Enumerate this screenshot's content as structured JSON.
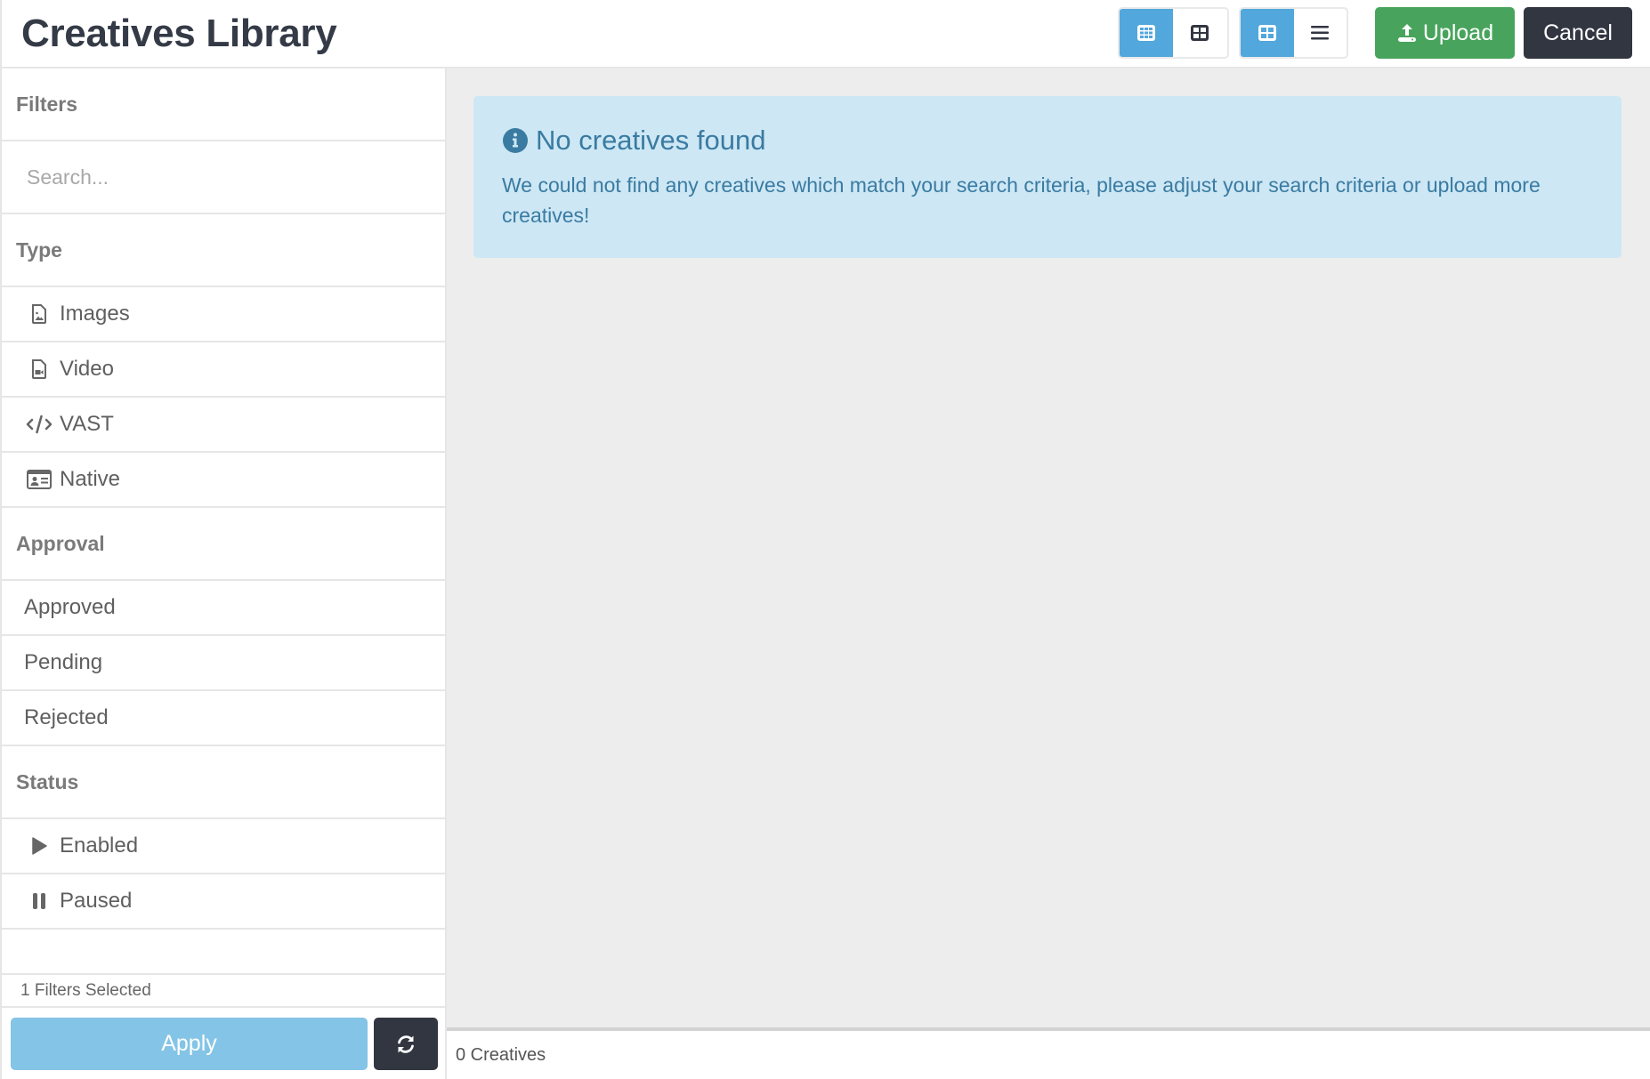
{
  "header": {
    "title": "Creatives Library",
    "view_toggle_1": [
      {
        "icon": "grid-small-icon",
        "active": true
      },
      {
        "icon": "grid-large-icon",
        "active": false
      }
    ],
    "view_toggle_2": [
      {
        "icon": "grid-view-icon",
        "active": true
      },
      {
        "icon": "list-view-icon",
        "active": false
      }
    ],
    "upload_label": "Upload",
    "cancel_label": "Cancel"
  },
  "sidebar": {
    "filters_label": "Filters",
    "search_placeholder": "Search...",
    "search_value": "",
    "type": {
      "label": "Type",
      "items": [
        {
          "label": "Images",
          "icon": "file-image-icon"
        },
        {
          "label": "Video",
          "icon": "file-video-icon"
        },
        {
          "label": "VAST",
          "icon": "code-icon"
        },
        {
          "label": "Native",
          "icon": "id-card-icon"
        }
      ]
    },
    "approval": {
      "label": "Approval",
      "items": [
        {
          "label": "Approved"
        },
        {
          "label": "Pending"
        },
        {
          "label": "Rejected"
        }
      ]
    },
    "status": {
      "label": "Status",
      "items": [
        {
          "label": "Enabled",
          "icon": "play-icon"
        },
        {
          "label": "Paused",
          "icon": "pause-icon"
        }
      ]
    },
    "filters_selected": "1 Filters Selected",
    "apply_label": "Apply",
    "refresh_icon": "refresh-icon"
  },
  "main": {
    "alert": {
      "icon": "info-circle-icon",
      "title": "No creatives found",
      "body": "We could not find any creatives which match your search criteria, please adjust your search criteria or upload more creatives!"
    },
    "footer_count": "0 Creatives"
  },
  "colors": {
    "accent_blue": "#52a7dc",
    "upload_green": "#48a45c",
    "dark": "#323641",
    "apply_disabled": "#84c4e6",
    "alert_bg": "#cde7f5",
    "alert_text": "#3a7ba1"
  }
}
